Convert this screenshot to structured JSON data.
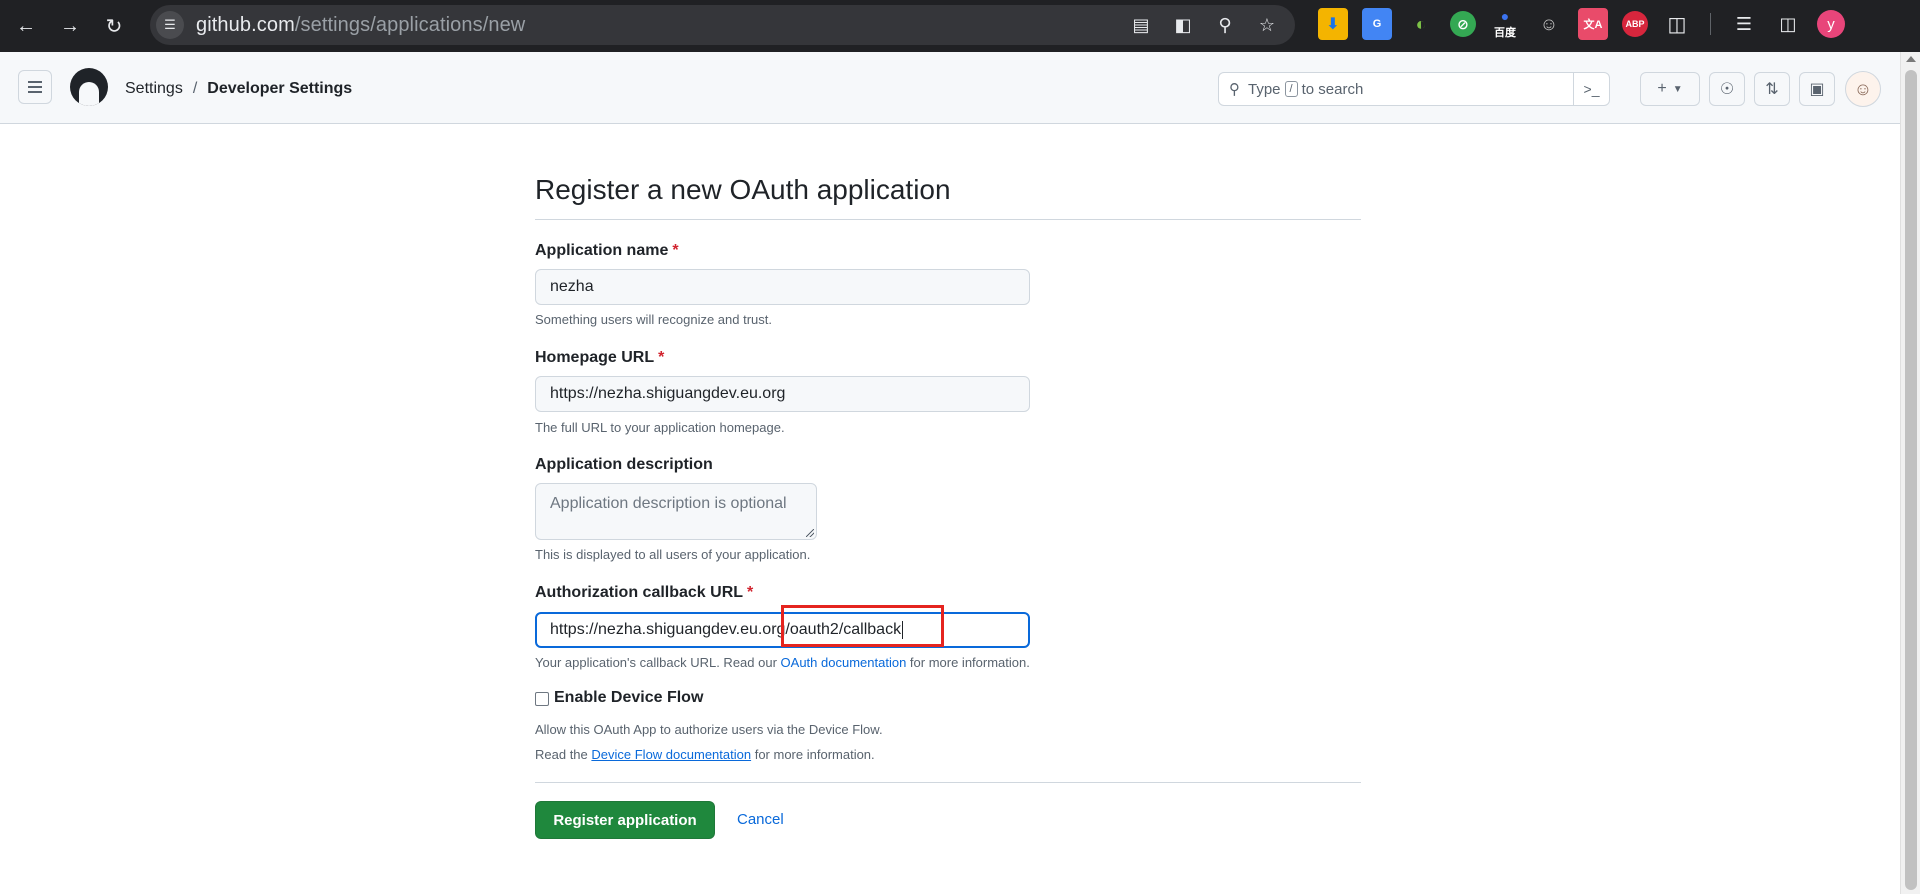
{
  "browser": {
    "url_host": "github.com",
    "url_path": "/settings/applications/new",
    "extensions": [
      {
        "name": "download-ext",
        "color": "#1a73e8",
        "glyph": "⬇"
      },
      {
        "name": "translate-ext",
        "color": "#4285f4",
        "glyph": "G"
      },
      {
        "name": "edge-ext",
        "color": "#2e7d32",
        "glyph": "◐"
      },
      {
        "name": "leaf-ext",
        "color": "#34a853",
        "glyph": "⊘"
      },
      {
        "name": "baidu-ext",
        "color": "#2b3b8c",
        "glyph": "百度"
      },
      {
        "name": "face-ext",
        "color": "#3c3c3c",
        "glyph": "☺"
      },
      {
        "name": "translate-cn-ext",
        "color": "#e94b6a",
        "glyph": "文A"
      },
      {
        "name": "abp-ext",
        "color": "#d7263d",
        "glyph": "ABP"
      }
    ],
    "profile_initial": "y"
  },
  "header": {
    "breadcrumb_settings": "Settings",
    "breadcrumb_sep": "/",
    "breadcrumb_developer": "Developer Settings",
    "search_prefix": "Type",
    "search_key": "/",
    "search_suffix": "to search"
  },
  "form": {
    "title": "Register a new OAuth application",
    "app_name_label": "Application name",
    "required_mark": "*",
    "app_name_value": "nezha",
    "app_name_hint": "Something users will recognize and trust.",
    "homepage_label": "Homepage URL",
    "homepage_value": "https://nezha.shiguangdev.eu.org",
    "homepage_hint": "The full URL to your application homepage.",
    "description_label": "Application description",
    "description_placeholder": "Application description is optional",
    "description_hint": "This is displayed to all users of your application.",
    "callback_label": "Authorization callback URL",
    "callback_value": "https://nezha.shiguangdev.eu.org/oauth2/callback",
    "callback_hint_prefix": "Your application's callback URL. Read our",
    "callback_hint_link": "OAuth documentation",
    "callback_hint_suffix": "for more information.",
    "device_flow_label": "Enable Device Flow",
    "device_flow_checked": false,
    "device_flow_hint1": "Allow this OAuth App to authorize users via the Device Flow.",
    "device_flow_hint2_prefix": "Read the",
    "device_flow_hint2_link": "Device Flow documentation",
    "device_flow_hint2_suffix": "for more information.",
    "submit_label": "Register application",
    "cancel_label": "Cancel"
  }
}
